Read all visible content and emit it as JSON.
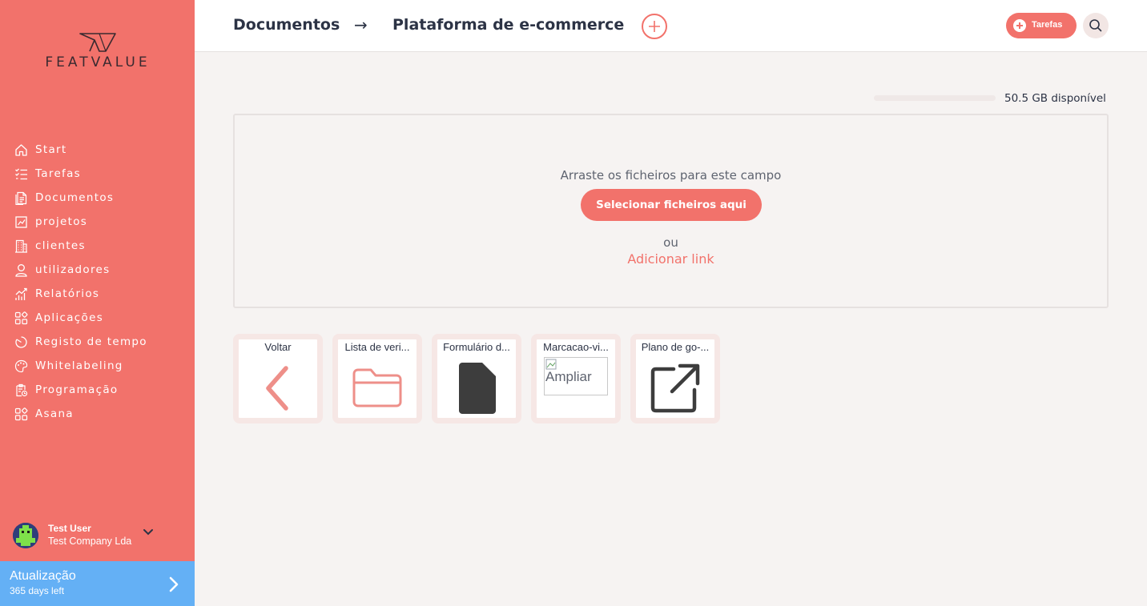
{
  "app": {
    "logo_text": "FEATVALUE"
  },
  "colors": {
    "accent": "#f2726b",
    "sidebar_bg": "#f2726b",
    "update_bg": "#64b0f5",
    "text_dark": "#2c3345",
    "content_bg": "#f6f3f2"
  },
  "sidebar": {
    "items": [
      {
        "label": "Start",
        "icon": "home-icon"
      },
      {
        "label": "Tarefas",
        "icon": "task-list-icon"
      },
      {
        "label": "Documentos",
        "icon": "documents-icon"
      },
      {
        "label": "projetos",
        "icon": "projects-icon"
      },
      {
        "label": "clientes",
        "icon": "building-icon"
      },
      {
        "label": "utilizadores",
        "icon": "user-icon"
      },
      {
        "label": "Relatórios",
        "icon": "reports-icon"
      },
      {
        "label": "Aplicações",
        "icon": "apps-icon"
      },
      {
        "label": "Registo de tempo",
        "icon": "timer-icon"
      },
      {
        "label": "Whitelabeling",
        "icon": "palette-icon"
      },
      {
        "label": "Programação",
        "icon": "schedule-icon"
      },
      {
        "label": "Asana",
        "icon": "apps-icon"
      }
    ],
    "user": {
      "name": "Test User",
      "company": "Test Company Lda"
    },
    "update": {
      "title": "Atualização",
      "subtitle": "365 days left"
    }
  },
  "header": {
    "breadcrumb": [
      "Documentos",
      "Plataforma de e-commerce"
    ],
    "arrow": "→",
    "tasks_label": "Tarefas"
  },
  "storage": {
    "text": "50.5 GB disponível",
    "used_fraction": 0.0
  },
  "dropzone": {
    "drag_text": "Arraste os ficheiros para este campo",
    "select_button": "Selecionar ficheiros aqui",
    "or_text": "ou",
    "link_text": "Adicionar link"
  },
  "tiles": [
    {
      "name": "Voltar",
      "icon": "chevron-left-icon"
    },
    {
      "name": "Lista de veri...",
      "icon": "folder-icon"
    },
    {
      "name": "Formulário d...",
      "icon": "file-icon"
    },
    {
      "name": "Marcacao-vi...",
      "icon": "broken-image-icon",
      "alt": "Ampliar"
    },
    {
      "name": "Plano de go-...",
      "icon": "external-link-icon"
    }
  ]
}
